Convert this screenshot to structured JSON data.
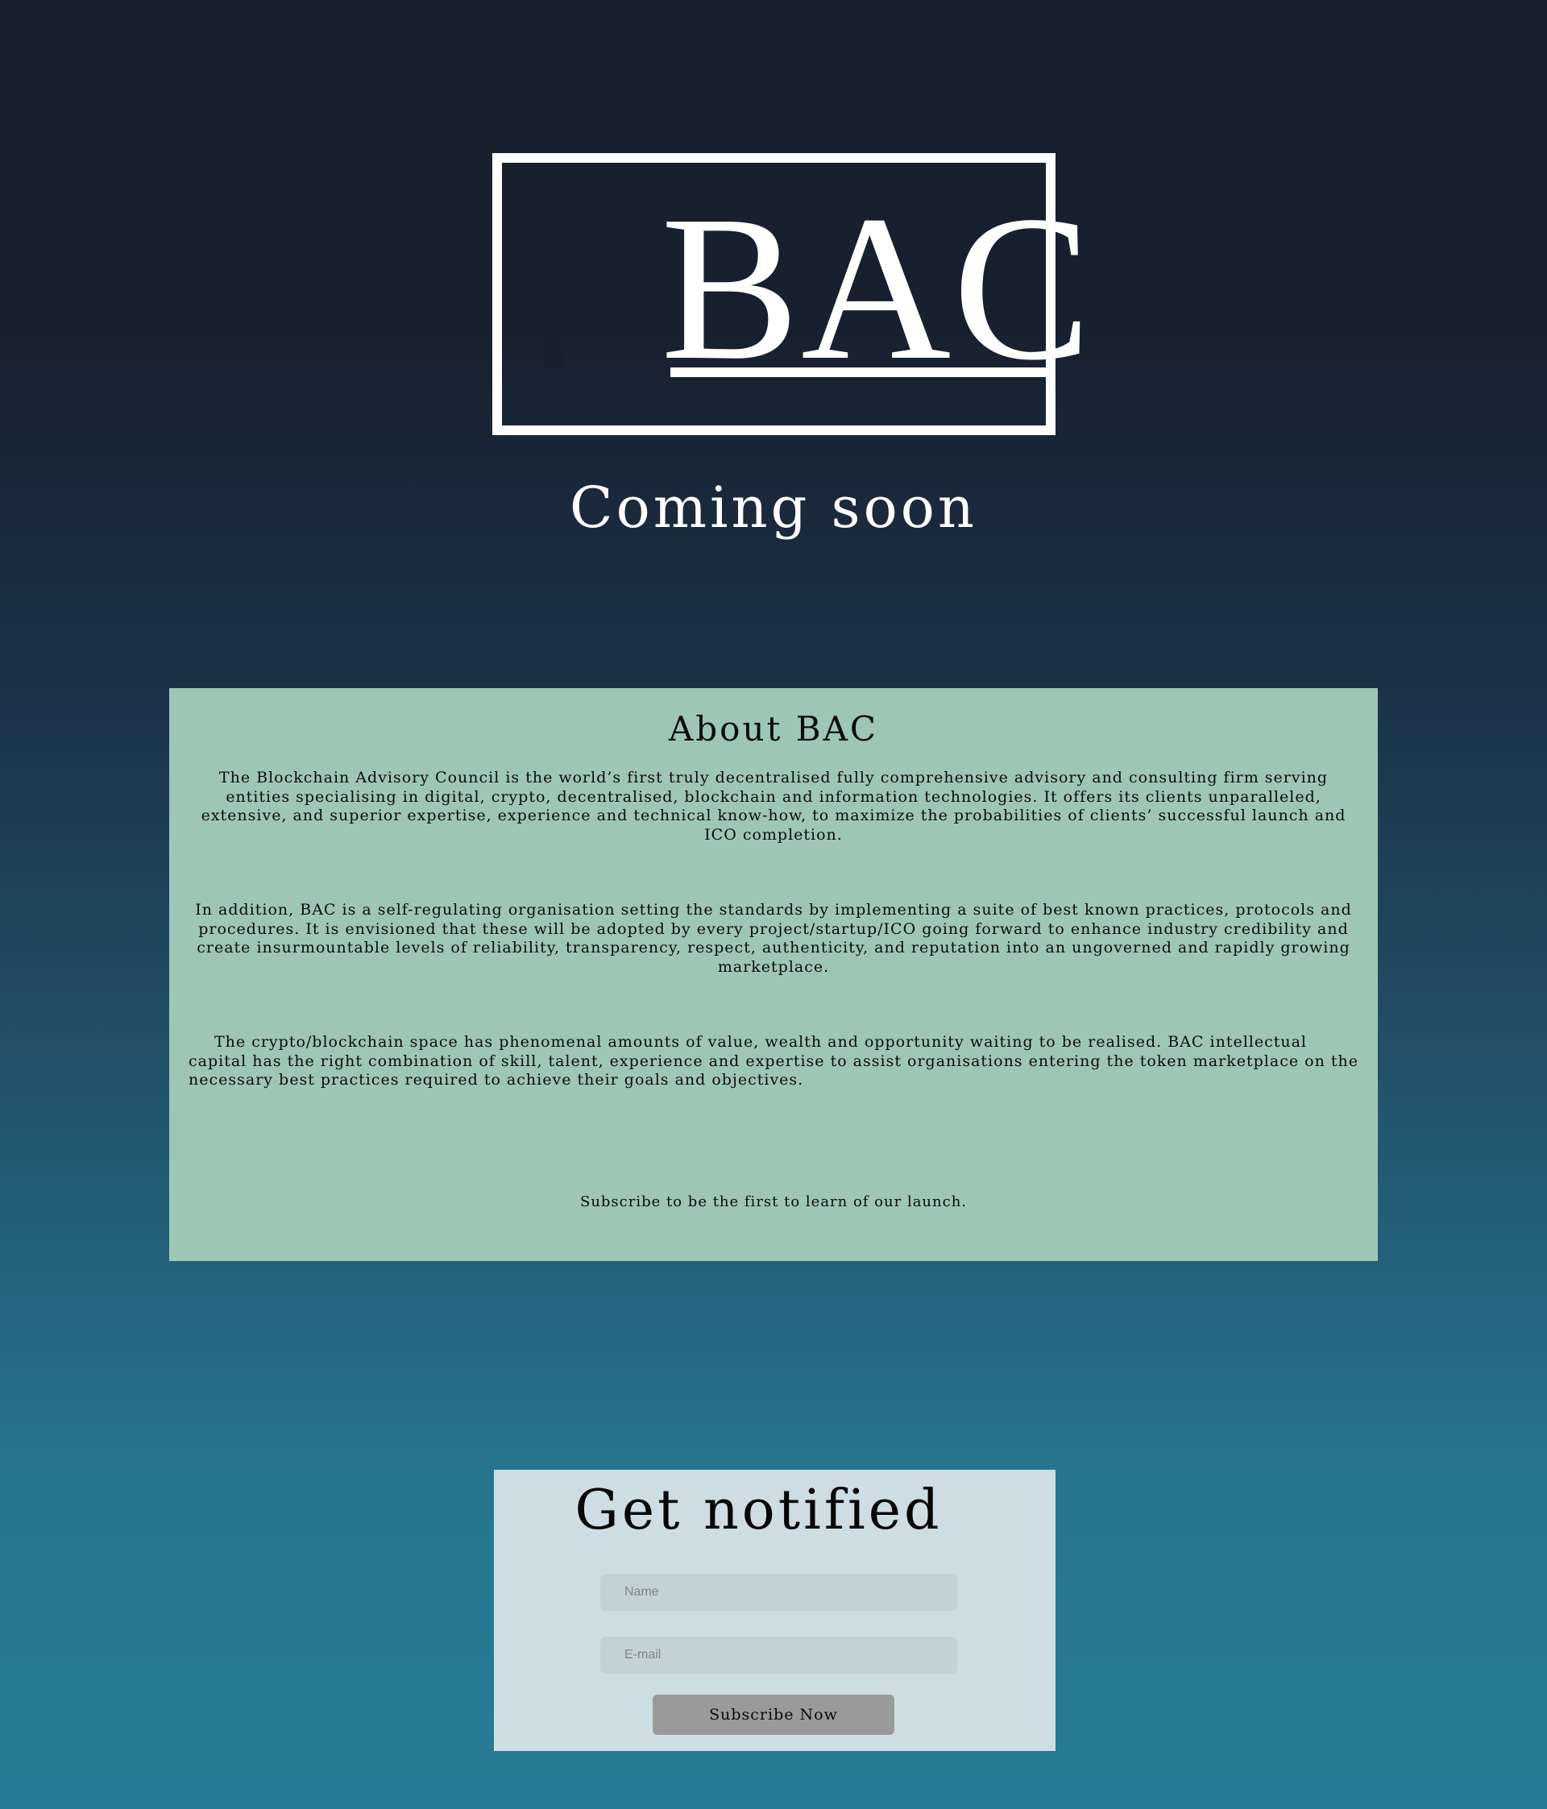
{
  "logo": {
    "text": "BAC"
  },
  "hero": {
    "tagline": "Coming soon"
  },
  "about": {
    "title": "About BAC",
    "paragraphs": [
      "The Blockchain Advisory Council is the world’s first truly decentralised fully comprehensive advisory and consulting firm serving entities specialising in digital, crypto, decentralised, blockchain and information technologies. It offers its clients unparalleled, extensive, and superior expertise, experience and technical know-how, to maximize the probabilities of clients’ successful launch and ICO completion.",
      "In addition, BAC is a self-regulating organisation setting the standards by implementing a suite of best known practices, protocols and procedures.  It is envisioned that these will be adopted by every project/startup/ICO going forward to enhance industry credibility and create insurmountable levels of reliability, transparency, respect, authenticity, and reputation into an ungoverned and rapidly growing marketplace.",
      "The crypto/blockchain space has phenomenal amounts of value, wealth and opportunity waiting to be realised. BAC intellectual capital has the right combination of skill, talent, experience and expertise to assist organisations entering the token marketplace on the necessary best practices required to achieve their goals and objectives."
    ],
    "subscribe_note": "Subscribe to be the first to learn of our launch."
  },
  "notify": {
    "title": "Get notified",
    "name_placeholder": "Name",
    "email_placeholder": "E-mail",
    "button_label": "Subscribe Now"
  },
  "colors": {
    "background_top": "#181f2e",
    "background_bottom": "#287b96",
    "about_panel": "#9dc6b6",
    "notify_panel": "#cedde4",
    "input_fill": "#c3d2d8",
    "button_fill": "#9a9a9a"
  }
}
